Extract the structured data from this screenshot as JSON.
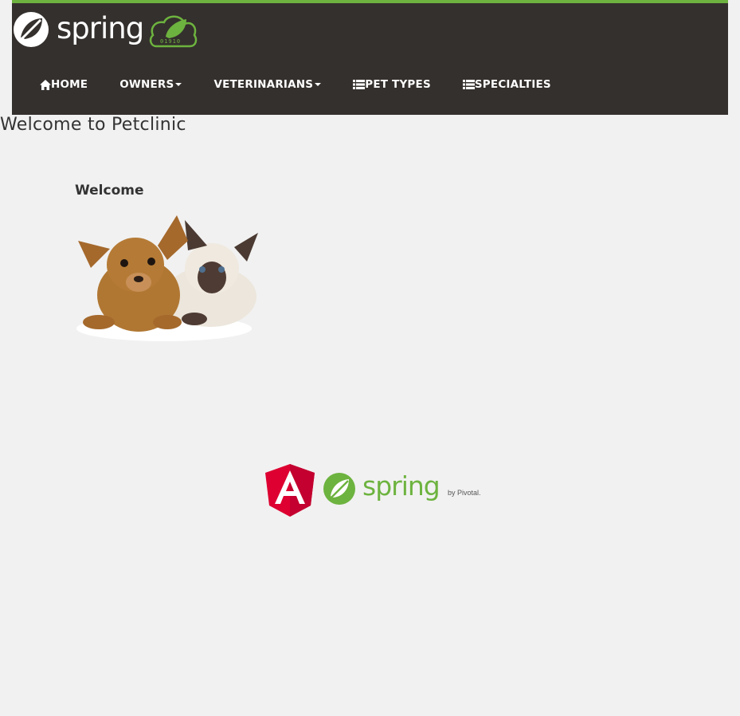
{
  "brand": {
    "name": "spring"
  },
  "nav": {
    "home": "HOME",
    "owners": "OWNERS",
    "veterinarians": "VETERINARIANS",
    "pet_types": "PET TYPES",
    "specialties": "SPECIALTIES"
  },
  "page": {
    "title": "Welcome to Petclinic",
    "welcome": "Welcome"
  },
  "footer": {
    "spring": "spring",
    "pivotal": "by Pivotal."
  },
  "colors": {
    "navbar_bg": "#34302d",
    "accent_green": "#6db33f",
    "page_bg": "#f1f1f1",
    "angular_red": "#dd0031"
  }
}
